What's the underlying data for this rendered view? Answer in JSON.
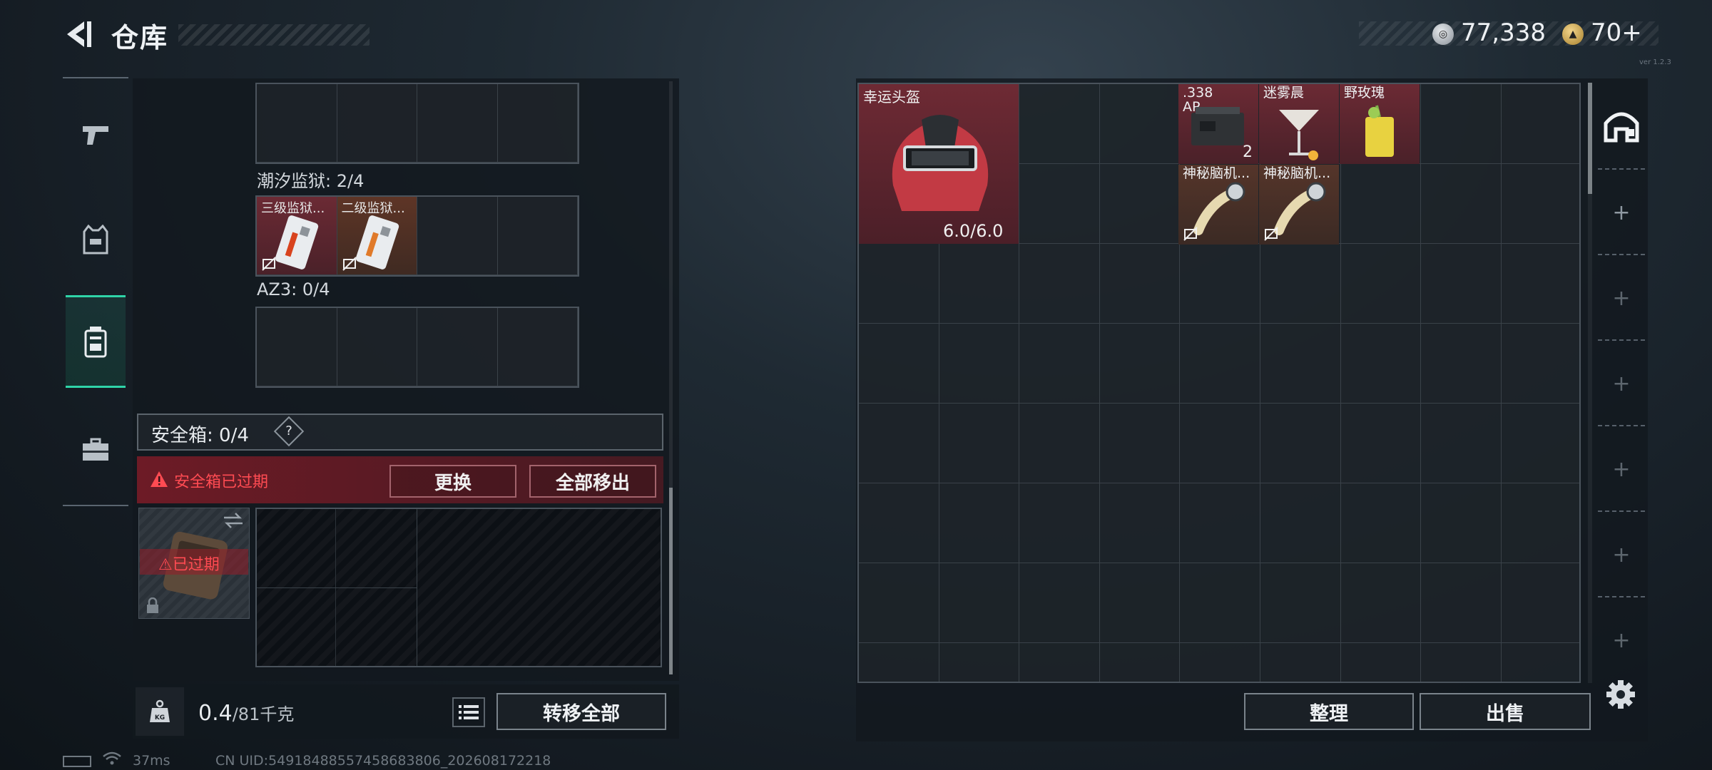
{
  "header": {
    "title": "仓库",
    "currency_silver": "77,338",
    "currency_gold": "70+",
    "tiny_text": "ver 1.2.3"
  },
  "nav": {
    "items": [
      {
        "icon": "pistol-icon"
      },
      {
        "icon": "armor-vest-icon"
      },
      {
        "icon": "backpack-icon",
        "active": true
      },
      {
        "icon": "toolbox-icon"
      }
    ]
  },
  "left_panel": {
    "section1_label": "潮汐监狱: 2/4",
    "section1_items": [
      {
        "name": "三级监狱...",
        "tint": "red"
      },
      {
        "name": "二级监狱...",
        "tint": "orange"
      }
    ],
    "section2_label": "AZ3: 0/4",
    "safebox": {
      "title": "安全箱: 0/4",
      "help": "?",
      "expired_warning": "安全箱已过期",
      "replace_button": "更换",
      "move_all_button": "全部移出",
      "case_status": "已过期"
    },
    "bottom": {
      "weight_value": "0.4",
      "weight_max": "/81千克",
      "transfer_button": "转移全部"
    }
  },
  "right_panel": {
    "items": [
      {
        "name": "幸运头盔",
        "durability": "6.0/6.0"
      },
      {
        "name": ".338\nAP",
        "count": "2"
      },
      {
        "name": "迷雾晨"
      },
      {
        "name": "野玫瑰"
      },
      {
        "name": "神秘脑机..."
      },
      {
        "name": "神秘脑机..."
      }
    ],
    "sort_button": "整理",
    "sell_button": "出售"
  },
  "status": {
    "ping": "37ms",
    "uid": "CN UID:549184885574586838​06_202608172218"
  },
  "colors": {
    "accent": "#2fd4a8",
    "warning": "#ff4b52",
    "item_red": "#6b2a34"
  }
}
